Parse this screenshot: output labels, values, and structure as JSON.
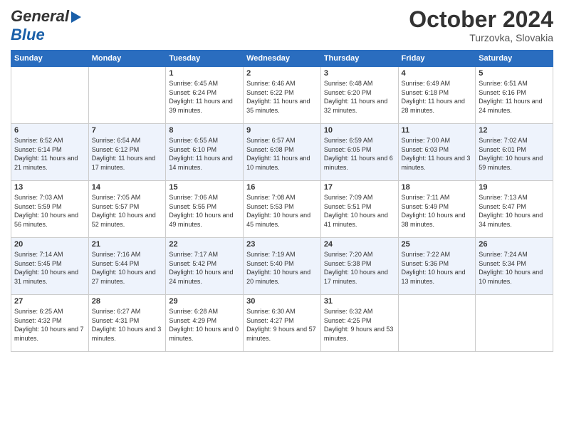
{
  "header": {
    "logo_line1": "General",
    "logo_line2": "Blue",
    "month": "October 2024",
    "location": "Turzovka, Slovakia"
  },
  "days_of_week": [
    "Sunday",
    "Monday",
    "Tuesday",
    "Wednesday",
    "Thursday",
    "Friday",
    "Saturday"
  ],
  "weeks": [
    [
      {
        "num": "",
        "sunrise": "",
        "sunset": "",
        "daylight": "",
        "empty": true
      },
      {
        "num": "",
        "sunrise": "",
        "sunset": "",
        "daylight": "",
        "empty": true
      },
      {
        "num": "1",
        "sunrise": "Sunrise: 6:45 AM",
        "sunset": "Sunset: 6:24 PM",
        "daylight": "Daylight: 11 hours and 39 minutes."
      },
      {
        "num": "2",
        "sunrise": "Sunrise: 6:46 AM",
        "sunset": "Sunset: 6:22 PM",
        "daylight": "Daylight: 11 hours and 35 minutes."
      },
      {
        "num": "3",
        "sunrise": "Sunrise: 6:48 AM",
        "sunset": "Sunset: 6:20 PM",
        "daylight": "Daylight: 11 hours and 32 minutes."
      },
      {
        "num": "4",
        "sunrise": "Sunrise: 6:49 AM",
        "sunset": "Sunset: 6:18 PM",
        "daylight": "Daylight: 11 hours and 28 minutes."
      },
      {
        "num": "5",
        "sunrise": "Sunrise: 6:51 AM",
        "sunset": "Sunset: 6:16 PM",
        "daylight": "Daylight: 11 hours and 24 minutes."
      }
    ],
    [
      {
        "num": "6",
        "sunrise": "Sunrise: 6:52 AM",
        "sunset": "Sunset: 6:14 PM",
        "daylight": "Daylight: 11 hours and 21 minutes."
      },
      {
        "num": "7",
        "sunrise": "Sunrise: 6:54 AM",
        "sunset": "Sunset: 6:12 PM",
        "daylight": "Daylight: 11 hours and 17 minutes."
      },
      {
        "num": "8",
        "sunrise": "Sunrise: 6:55 AM",
        "sunset": "Sunset: 6:10 PM",
        "daylight": "Daylight: 11 hours and 14 minutes."
      },
      {
        "num": "9",
        "sunrise": "Sunrise: 6:57 AM",
        "sunset": "Sunset: 6:08 PM",
        "daylight": "Daylight: 11 hours and 10 minutes."
      },
      {
        "num": "10",
        "sunrise": "Sunrise: 6:59 AM",
        "sunset": "Sunset: 6:05 PM",
        "daylight": "Daylight: 11 hours and 6 minutes."
      },
      {
        "num": "11",
        "sunrise": "Sunrise: 7:00 AM",
        "sunset": "Sunset: 6:03 PM",
        "daylight": "Daylight: 11 hours and 3 minutes."
      },
      {
        "num": "12",
        "sunrise": "Sunrise: 7:02 AM",
        "sunset": "Sunset: 6:01 PM",
        "daylight": "Daylight: 10 hours and 59 minutes."
      }
    ],
    [
      {
        "num": "13",
        "sunrise": "Sunrise: 7:03 AM",
        "sunset": "Sunset: 5:59 PM",
        "daylight": "Daylight: 10 hours and 56 minutes."
      },
      {
        "num": "14",
        "sunrise": "Sunrise: 7:05 AM",
        "sunset": "Sunset: 5:57 PM",
        "daylight": "Daylight: 10 hours and 52 minutes."
      },
      {
        "num": "15",
        "sunrise": "Sunrise: 7:06 AM",
        "sunset": "Sunset: 5:55 PM",
        "daylight": "Daylight: 10 hours and 49 minutes."
      },
      {
        "num": "16",
        "sunrise": "Sunrise: 7:08 AM",
        "sunset": "Sunset: 5:53 PM",
        "daylight": "Daylight: 10 hours and 45 minutes."
      },
      {
        "num": "17",
        "sunrise": "Sunrise: 7:09 AM",
        "sunset": "Sunset: 5:51 PM",
        "daylight": "Daylight: 10 hours and 41 minutes."
      },
      {
        "num": "18",
        "sunrise": "Sunrise: 7:11 AM",
        "sunset": "Sunset: 5:49 PM",
        "daylight": "Daylight: 10 hours and 38 minutes."
      },
      {
        "num": "19",
        "sunrise": "Sunrise: 7:13 AM",
        "sunset": "Sunset: 5:47 PM",
        "daylight": "Daylight: 10 hours and 34 minutes."
      }
    ],
    [
      {
        "num": "20",
        "sunrise": "Sunrise: 7:14 AM",
        "sunset": "Sunset: 5:45 PM",
        "daylight": "Daylight: 10 hours and 31 minutes."
      },
      {
        "num": "21",
        "sunrise": "Sunrise: 7:16 AM",
        "sunset": "Sunset: 5:44 PM",
        "daylight": "Daylight: 10 hours and 27 minutes."
      },
      {
        "num": "22",
        "sunrise": "Sunrise: 7:17 AM",
        "sunset": "Sunset: 5:42 PM",
        "daylight": "Daylight: 10 hours and 24 minutes."
      },
      {
        "num": "23",
        "sunrise": "Sunrise: 7:19 AM",
        "sunset": "Sunset: 5:40 PM",
        "daylight": "Daylight: 10 hours and 20 minutes."
      },
      {
        "num": "24",
        "sunrise": "Sunrise: 7:20 AM",
        "sunset": "Sunset: 5:38 PM",
        "daylight": "Daylight: 10 hours and 17 minutes."
      },
      {
        "num": "25",
        "sunrise": "Sunrise: 7:22 AM",
        "sunset": "Sunset: 5:36 PM",
        "daylight": "Daylight: 10 hours and 13 minutes."
      },
      {
        "num": "26",
        "sunrise": "Sunrise: 7:24 AM",
        "sunset": "Sunset: 5:34 PM",
        "daylight": "Daylight: 10 hours and 10 minutes."
      }
    ],
    [
      {
        "num": "27",
        "sunrise": "Sunrise: 6:25 AM",
        "sunset": "Sunset: 4:32 PM",
        "daylight": "Daylight: 10 hours and 7 minutes."
      },
      {
        "num": "28",
        "sunrise": "Sunrise: 6:27 AM",
        "sunset": "Sunset: 4:31 PM",
        "daylight": "Daylight: 10 hours and 3 minutes."
      },
      {
        "num": "29",
        "sunrise": "Sunrise: 6:28 AM",
        "sunset": "Sunset: 4:29 PM",
        "daylight": "Daylight: 10 hours and 0 minutes."
      },
      {
        "num": "30",
        "sunrise": "Sunrise: 6:30 AM",
        "sunset": "Sunset: 4:27 PM",
        "daylight": "Daylight: 9 hours and 57 minutes."
      },
      {
        "num": "31",
        "sunrise": "Sunrise: 6:32 AM",
        "sunset": "Sunset: 4:25 PM",
        "daylight": "Daylight: 9 hours and 53 minutes."
      },
      {
        "num": "",
        "sunrise": "",
        "sunset": "",
        "daylight": "",
        "empty": true
      },
      {
        "num": "",
        "sunrise": "",
        "sunset": "",
        "daylight": "",
        "empty": true
      }
    ]
  ]
}
